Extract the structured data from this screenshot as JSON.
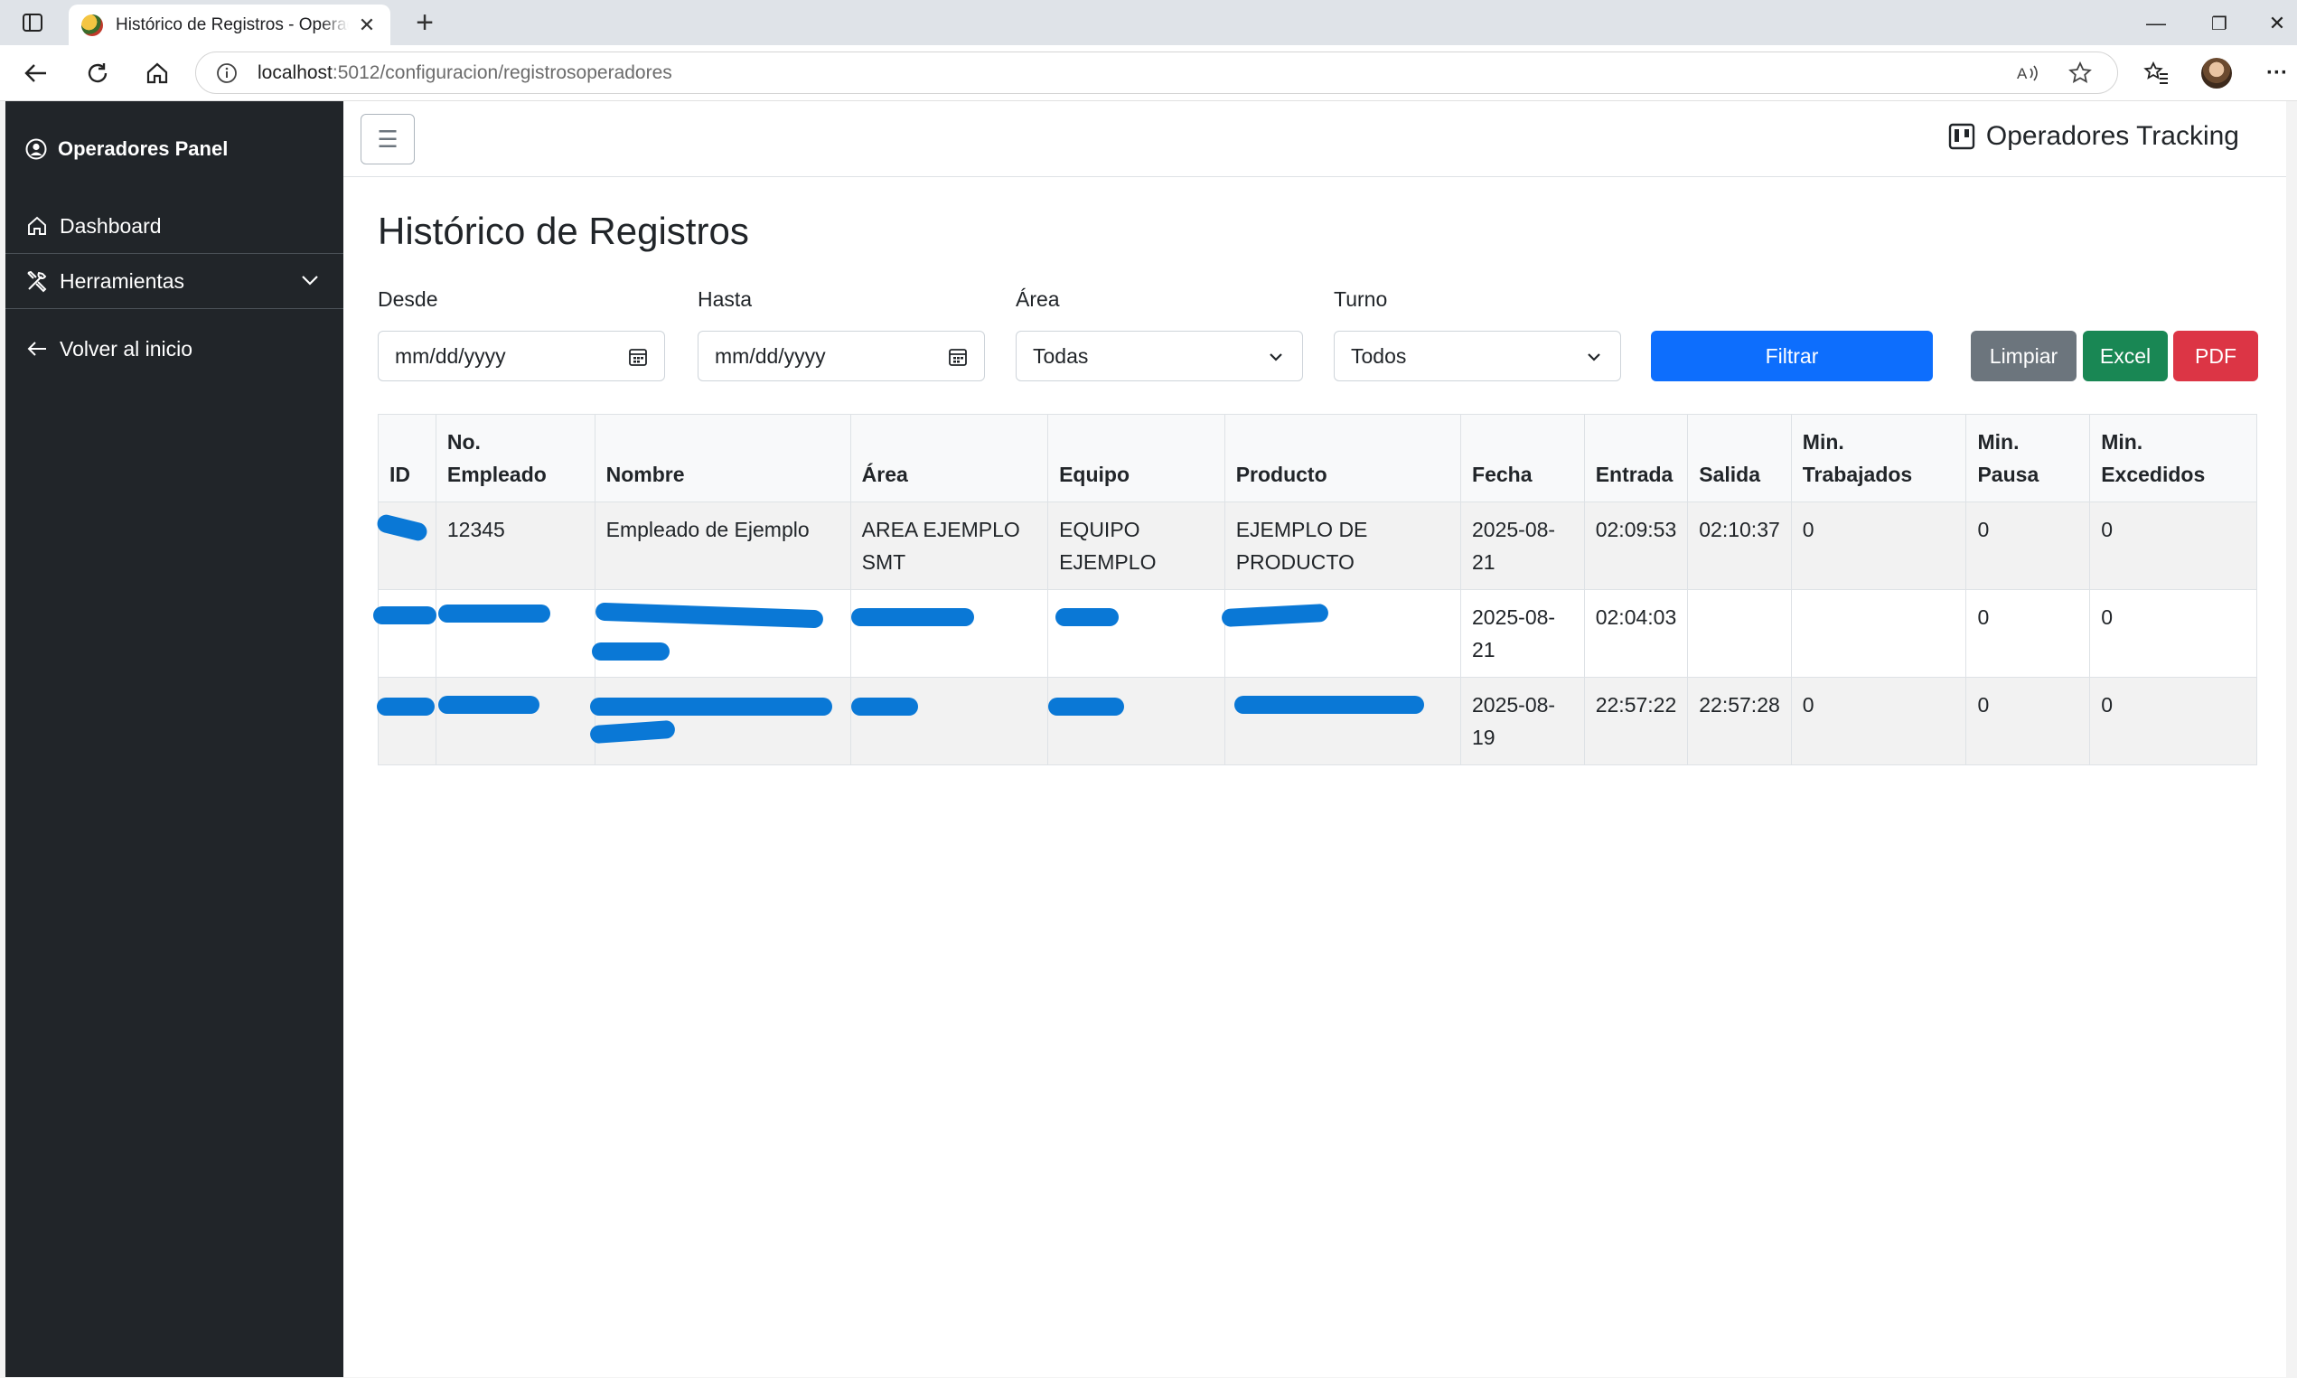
{
  "browser": {
    "tab_title": "Histórico de Registros - Operadores Tracking",
    "close_symbol": "✕",
    "new_tab_symbol": "+",
    "url_host": "localhost",
    "url_path": ":5012/configuracion/registrosoperadores",
    "window_controls": [
      "—",
      "❐",
      "✕"
    ],
    "menu_symbol": "···"
  },
  "sidebar": {
    "brand": "Operadores Panel",
    "items": [
      {
        "label": "Dashboard",
        "icon": "home-icon"
      },
      {
        "label": "Herramientas",
        "icon": "tools-icon"
      },
      {
        "label": "Volver al inicio",
        "icon": "arrow-left-icon"
      }
    ]
  },
  "topnav": {
    "toggle_symbol": "☰",
    "app_title": "Operadores Tracking"
  },
  "page": {
    "title": "Histórico de Registros"
  },
  "filters": {
    "desde_label": "Desde",
    "desde_value": "mm/dd/yyyy",
    "hasta_label": "Hasta",
    "hasta_value": "mm/dd/yyyy",
    "area_label": "Área",
    "area_value": "Todas",
    "turno_label": "Turno",
    "turno_value": "Todos",
    "filtrar": "Filtrar",
    "limpiar": "Limpiar",
    "excel": "Excel",
    "pdf": "PDF"
  },
  "colors": {
    "primary": "#0d6efd",
    "secondary": "#6c757d",
    "success": "#198754",
    "danger": "#dc3545",
    "sidebar": "#212529",
    "redaction": "#0a78d6"
  },
  "table": {
    "headers": {
      "id": "ID",
      "no_empleado_1": "No.",
      "no_empleado_2": "Empleado",
      "nombre": "Nombre",
      "area": "Área",
      "equipo": "Equipo",
      "producto": "Producto",
      "fecha": "Fecha",
      "entrada": "Entrada",
      "salida": "Salida",
      "min_trab_1": "Min.",
      "min_trab_2": "Trabajados",
      "min_pausa_1": "Min.",
      "min_pausa_2": "Pausa",
      "min_exc_1": "Min.",
      "min_exc_2": "Excedidos"
    },
    "rows": [
      {
        "id": "",
        "no_empleado": "12345",
        "nombre": "Empleado de Ejemplo",
        "area_1": "AREA EJEMPLO",
        "area_2": "SMT",
        "equipo_1": "EQUIPO",
        "equipo_2": "EJEMPLO",
        "producto_1": "EJEMPLO DE",
        "producto_2": "PRODUCTO",
        "fecha_1": "2025-08-",
        "fecha_2": "21",
        "entrada": "02:09:53",
        "salida": "02:10:37",
        "min_trabajados": "0",
        "min_pausa": "0",
        "min_excedidos": "0"
      },
      {
        "id": "",
        "no_empleado": "",
        "nombre": "",
        "area_1": "",
        "area_2": "",
        "equipo_1": "",
        "equipo_2": "",
        "producto_1": "",
        "producto_2": "",
        "fecha_1": "2025-08-",
        "fecha_2": "21",
        "entrada": "02:04:03",
        "salida": "",
        "min_trabajados": "",
        "min_pausa": "0",
        "min_excedidos": "0"
      },
      {
        "id": "",
        "no_empleado": "",
        "nombre": "",
        "area_1": "",
        "area_2": "",
        "equipo_1": "",
        "equipo_2": "",
        "producto_1": "",
        "producto_2": "",
        "fecha_1": "2025-08-",
        "fecha_2": "19",
        "entrada": "22:57:22",
        "salida": "22:57:28",
        "min_trabajados": "0",
        "min_pausa": "0",
        "min_excedidos": "0"
      }
    ]
  }
}
